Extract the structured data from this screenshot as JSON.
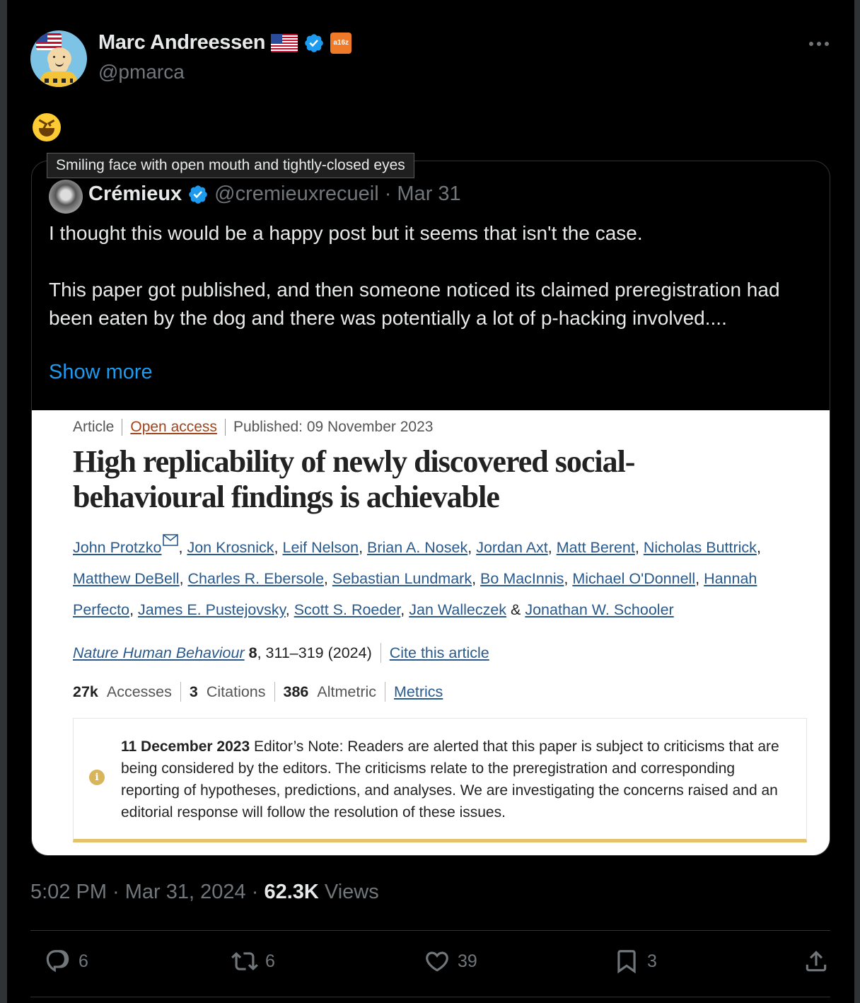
{
  "author": {
    "name": "Marc Andreessen",
    "handle": "@pmarca",
    "badge": "a16z"
  },
  "post": {
    "emoji_tooltip": "Smiling face with open mouth and tightly-closed eyes",
    "timestamp": "5:02 PM · Mar 31, 2024 · ",
    "views_count": "62.3K",
    "views_label": " Views"
  },
  "quote": {
    "name": "Crémieux",
    "handle": "@cremieuxrecueil",
    "date": "· Mar 31",
    "text": "I thought this would be a happy post but it seems that isn't the case.\n\nThis paper got published, and then someone noticed its claimed preregistration had been eaten by the dog and there was potentially a lot of p-hacking involved....",
    "show_more": "Show more"
  },
  "article": {
    "type": "Article",
    "access": "Open access",
    "published": "Published: 09 November 2023",
    "title": "High replicability of newly discovered social-behavioural findings is achievable",
    "authors": [
      "John Protzko",
      "Jon Krosnick",
      "Leif Nelson",
      "Brian A. Nosek",
      "Jordan Axt",
      "Matt Berent",
      "Nicholas Buttrick",
      "Matthew DeBell",
      "Charles R. Ebersole",
      "Sebastian Lundmark",
      "Bo MacInnis",
      "Michael O'Donnell",
      "Hannah Perfecto",
      "James E. Pustejovsky",
      "Scott S. Roeder",
      "Jan Walleczek",
      "Jonathan W. Schooler"
    ],
    "author_mail_icon": "mail-icon",
    "journal": "Nature Human Behaviour",
    "volume": "8",
    "pages": ", 311–319 (2024)",
    "cite": "Cite this article",
    "accesses_value": "27k",
    "accesses_label": "Accesses",
    "citations_value": "3",
    "citations_label": "Citations",
    "altmetric_value": "386",
    "altmetric_label": "Altmetric",
    "metrics_link": "Metrics",
    "note_date": "11 December 2023",
    "note_text": " Editor’s Note: Readers are alerted that this paper is subject to criticisms that are being considered by the editors. The criticisms relate to the preregistration and corresponding reporting of hypotheses, predictions, and analyses. We are investigating the concerns raised and an editorial response will follow the resolution of these issues."
  },
  "actions": {
    "replies": "6",
    "reposts": "6",
    "likes": "39",
    "bookmarks": "3"
  },
  "colors": {
    "background": "#000000",
    "accent": "#1d9bf0",
    "muted": "#71767b",
    "link": "#2a5a8c",
    "note_border": "#e2c36b"
  }
}
